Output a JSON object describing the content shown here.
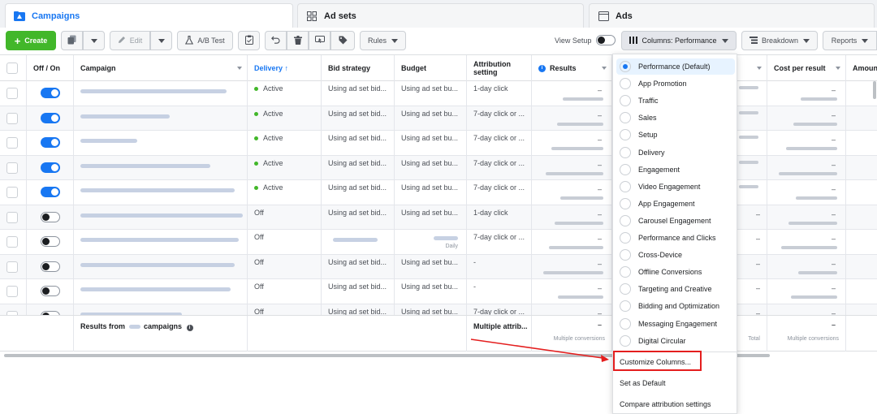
{
  "tabs": [
    {
      "label": "Campaigns",
      "icon": "campaigns-icon"
    },
    {
      "label": "Ad sets",
      "icon": "ad-sets-icon"
    },
    {
      "label": "Ads",
      "icon": "ads-icon"
    }
  ],
  "toolbar": {
    "create_label": "Create",
    "edit_label": "Edit",
    "ab_test_label": "A/B Test",
    "rules_label": "Rules",
    "view_setup_label": "View Setup",
    "columns_label": "Columns: Performance",
    "breakdown_label": "Breakdown",
    "reports_label": "Reports"
  },
  "table": {
    "headers": [
      "Off / On",
      "Campaign",
      "Delivery ↑",
      "Bid strategy",
      "Budget",
      "Attribution setting",
      "Results",
      "Cost per result",
      "Amount"
    ],
    "rows": [
      {
        "on": true,
        "delivery": "Active",
        "bid": "Using ad set bid...",
        "budget": "Using ad set bu...",
        "attribution": "1-day click",
        "result": "–"
      },
      {
        "on": true,
        "delivery": "Active",
        "bid": "Using ad set bid...",
        "budget": "Using ad set bu...",
        "attribution": "7-day click or ...",
        "result": "–"
      },
      {
        "on": true,
        "delivery": "Active",
        "bid": "Using ad set bid...",
        "budget": "Using ad set bu...",
        "attribution": "7-day click or ...",
        "result": "–"
      },
      {
        "on": true,
        "delivery": "Active",
        "bid": "Using ad set bid...",
        "budget": "Using ad set bu...",
        "attribution": "7-day click or ...",
        "result": "–"
      },
      {
        "on": true,
        "delivery": "Active",
        "bid": "Using ad set bid...",
        "budget": "Using ad set bu...",
        "attribution": "7-day click or ...",
        "result": "–"
      },
      {
        "on": false,
        "delivery": "Off",
        "bid": "Using ad set bid...",
        "budget": "Using ad set bu...",
        "attribution": "1-day click",
        "result": "–"
      },
      {
        "on": false,
        "delivery": "Off",
        "bid": "",
        "budget": "Daily",
        "attribution": "7-day click or ...",
        "result": "–"
      },
      {
        "on": false,
        "delivery": "Off",
        "bid": "Using ad set bid...",
        "budget": "Using ad set bu...",
        "attribution": "-",
        "result": "–"
      },
      {
        "on": false,
        "delivery": "Off",
        "bid": "Using ad set bid...",
        "budget": "Using ad set bu...",
        "attribution": "-",
        "result": "–"
      },
      {
        "on": false,
        "delivery": "Off",
        "bid": "Using ad set bid...",
        "budget": "Using ad set bu...",
        "attribution": "7-day click or ...",
        "result": "–"
      }
    ],
    "footer": {
      "results_label": "Results from",
      "campaigns_label": "campaigns",
      "attribution": "Multiple attrib...",
      "results_sub": "Multiple conversions",
      "total_sub": "Total",
      "cost_sub": "Multiple conversions",
      "dash": "–"
    }
  },
  "dropdown": {
    "presets": [
      "Performance (Default)",
      "App Promotion",
      "Traffic",
      "Sales",
      "Setup",
      "Delivery",
      "Engagement",
      "Video Engagement",
      "App Engagement",
      "Carousel Engagement",
      "Performance and Clicks",
      "Cross-Device",
      "Offline Conversions",
      "Targeting and Creative",
      "Bidding and Optimization",
      "Messaging Engagement",
      "Digital Circular"
    ],
    "selected_index": 0,
    "customize_label": "Customize Columns...",
    "set_default_label": "Set as Default",
    "compare_label": "Compare attribution settings"
  },
  "colors": {
    "accent": "#1877f2",
    "create": "#42b72a",
    "active_dot": "#42b72a",
    "annotation": "#e41e1e"
  }
}
